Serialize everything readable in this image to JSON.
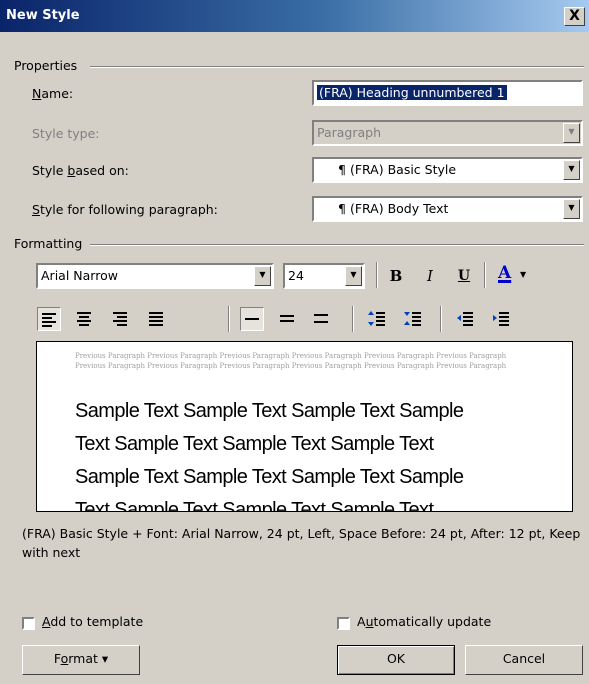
{
  "window": {
    "title": "New Style",
    "close_label": "X"
  },
  "properties": {
    "group_label": "Properties",
    "name_label": "Name:",
    "name_value": "(FRA) Heading unnumbered 1",
    "style_type_label": "Style type:",
    "style_type_value": "Paragraph",
    "based_on_label": "Style based on:",
    "based_on_value": "(FRA) Basic Style",
    "following_label": "Style for following paragraph:",
    "following_value": "(FRA) Body Text",
    "pilcrow": "¶"
  },
  "formatting": {
    "group_label": "Formatting",
    "font_name": "Arial Narrow",
    "font_size": "24",
    "bold_label": "B",
    "italic_label": "I",
    "underline_label": "U",
    "font_color_label": "A",
    "font_color": "#0000cc"
  },
  "preview": {
    "previous_paragraph_lines": [
      "Previous Paragraph Previous Paragraph Previous Paragraph Previous Paragraph Previous Paragraph Previous Paragraph",
      "Previous Paragraph Previous Paragraph Previous Paragraph Previous Paragraph Previous Paragraph Previous Paragraph"
    ],
    "sample_lines": [
      "Sample Text Sample Text Sample Text Sample",
      "Text Sample Text Sample Text Sample Text",
      "Sample Text Sample Text Sample Text Sample",
      "Text Sample Text Sample Text Sample Text"
    ]
  },
  "description": "(FRA) Basic Style + Font: Arial Narrow, 24 pt, Left, Space Before:  24 pt, After:  12 pt, Keep with next",
  "options": {
    "add_to_template_label": "Add to template",
    "add_to_template_checked": false,
    "auto_update_label": "Automatically update",
    "auto_update_checked": false
  },
  "buttons": {
    "format_label": "Format",
    "ok_label": "OK",
    "cancel_label": "Cancel"
  }
}
